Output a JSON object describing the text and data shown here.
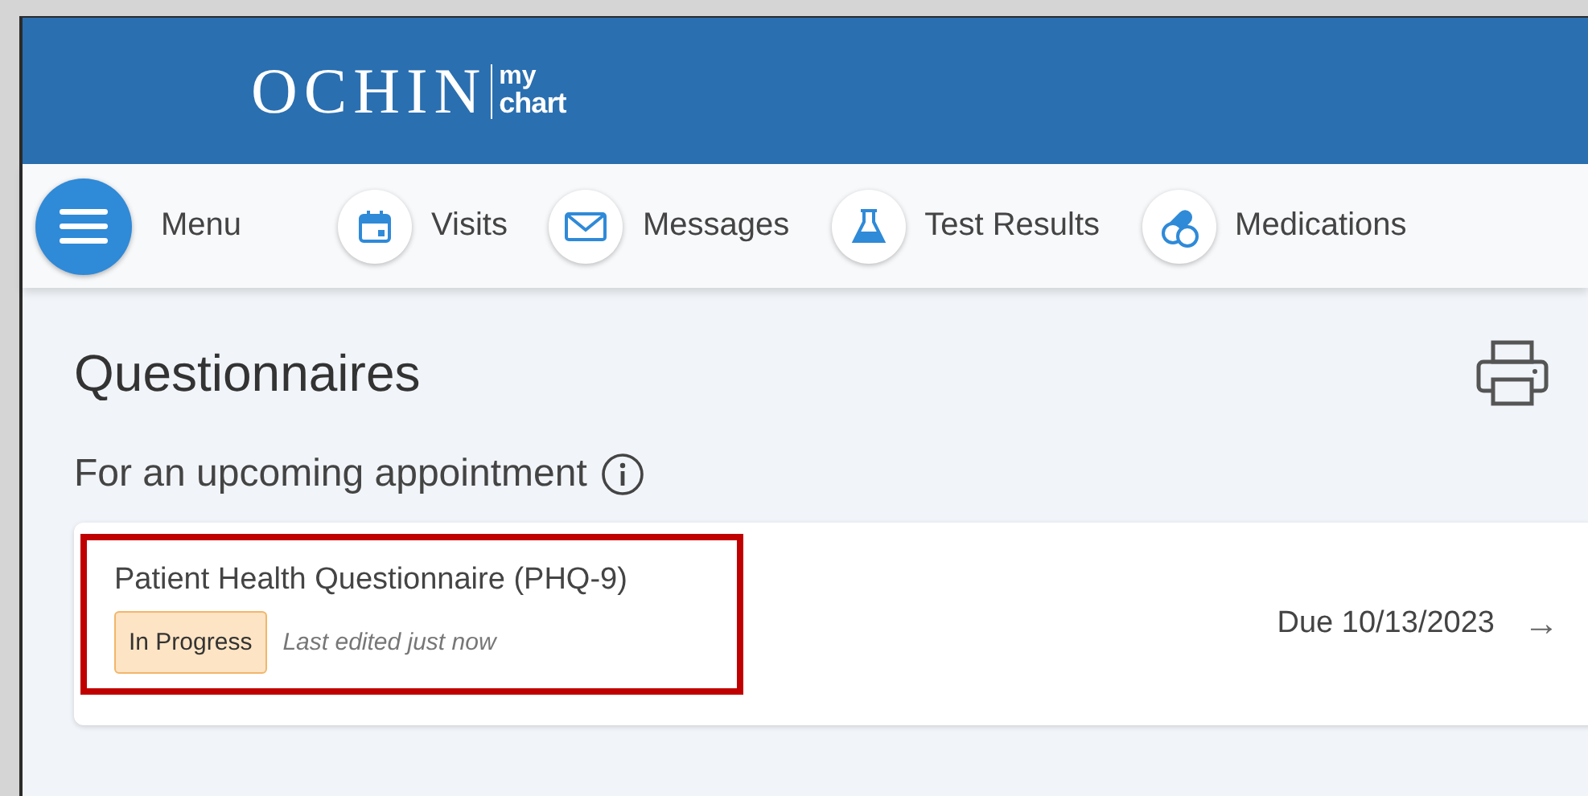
{
  "header": {
    "logo": {
      "brand": "OCHIN",
      "sub_top": "my",
      "sub_bottom": "chart"
    }
  },
  "nav": [
    {
      "kind": "menu",
      "label": "Menu"
    },
    {
      "kind": "link",
      "label": "Visits"
    },
    {
      "kind": "link",
      "label": "Messages"
    },
    {
      "kind": "link",
      "label": "Test Results"
    },
    {
      "kind": "link",
      "label": "Medications"
    }
  ],
  "page": {
    "title": "Questionnaires",
    "section": "For an upcoming appointment",
    "questionnaires": [
      {
        "title": "Patient Health Questionnaire (PHQ-9)",
        "status": "In Progress",
        "edited": "Last edited just now",
        "due": "Due 10/13/2023",
        "arrow": "→",
        "highlighted": true
      }
    ]
  }
}
